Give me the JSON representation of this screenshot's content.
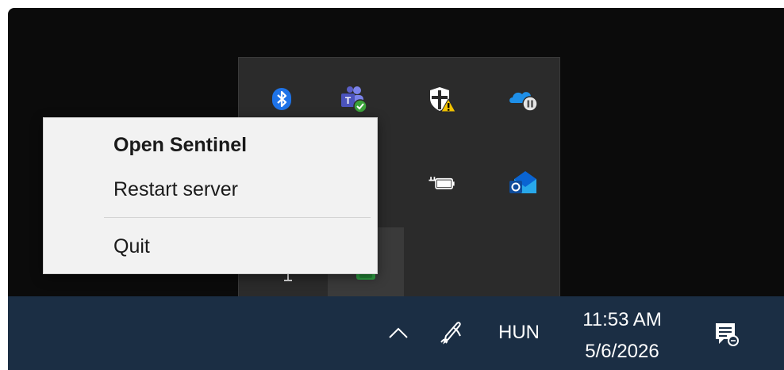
{
  "context_menu": {
    "items": [
      {
        "label": "Open Sentinel",
        "default": true
      },
      {
        "label": "Restart server",
        "default": false
      },
      {
        "label": "Quit",
        "default": false
      }
    ]
  },
  "tray_flyout": {
    "icons": [
      "bluetooth-icon",
      "teams-icon",
      "security-warning-icon",
      "onedrive-paused-icon",
      "hidden-icon",
      "power-battery-icon",
      "outlook-icon",
      "usb-icon",
      "app-green-icon"
    ]
  },
  "taskbar": {
    "show_hidden_icon": "chevron-up-icon",
    "pen_icon": "pen-icon",
    "language": "HUN",
    "time": "11:53 AM",
    "date": "5/6/2026",
    "notifications_icon": "notification-center-icon"
  },
  "colors": {
    "desktop": "#0b0b0b",
    "flyout": "#2b2b2b",
    "taskbar": "#1b2e44",
    "menu": "#f2f2f2",
    "teams_badge": "#3ba33a",
    "warning": "#f2c200",
    "outlook": "#0a64d2"
  }
}
